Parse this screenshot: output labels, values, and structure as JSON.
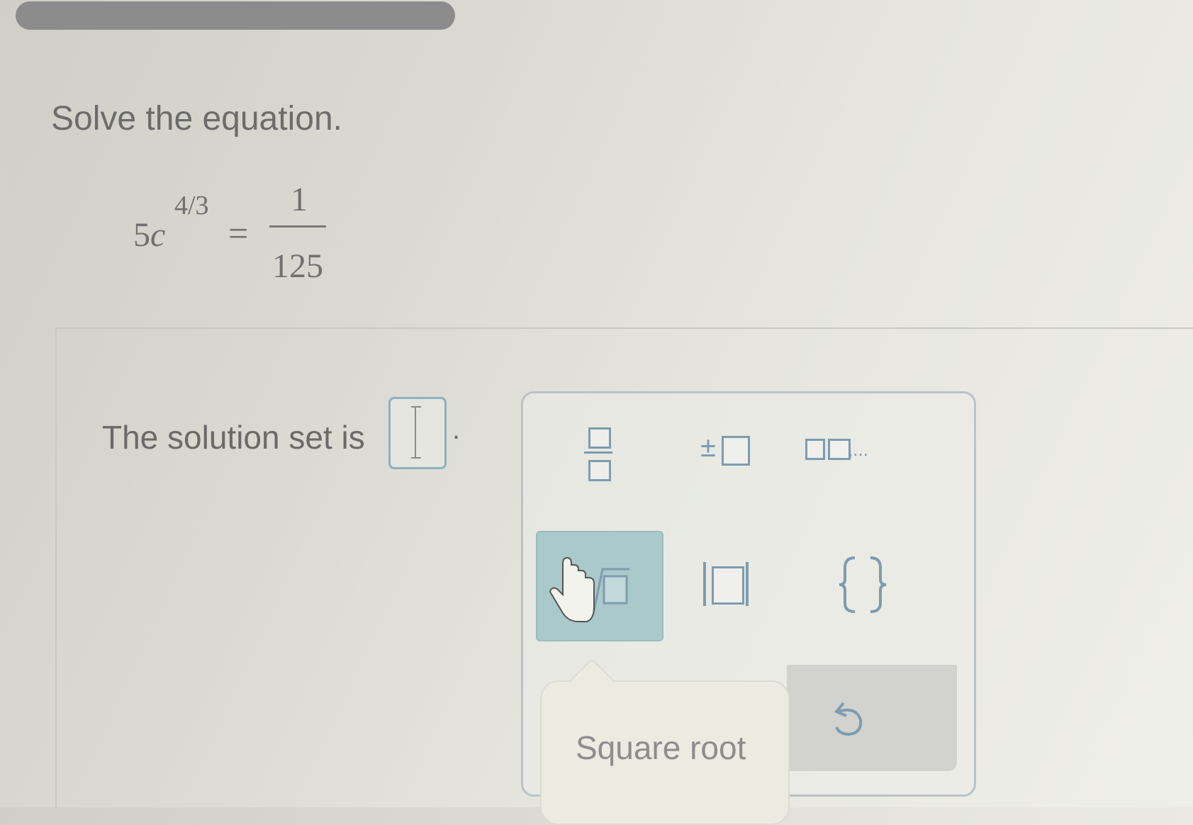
{
  "question": {
    "prompt": "Solve the equation.",
    "equation": {
      "coefficient": "5",
      "variable": "c",
      "exponent": "4/3",
      "equals": "=",
      "numerator": "1",
      "denominator": "125"
    }
  },
  "answer": {
    "label": "The solution set is",
    "value": "",
    "period": "."
  },
  "palette": {
    "buttons": [
      "fraction-icon",
      "plus-minus-icon",
      "list-icon",
      "nth-root-icon",
      "absolute-value-icon",
      "set-braces-icon"
    ],
    "plus_minus": "±",
    "list_ellipsis": ",...",
    "tooltip": "Square root",
    "undo": "undo-icon"
  },
  "colors": {
    "accent": "#8fb0c0",
    "active_button": "#a9c9cb"
  }
}
